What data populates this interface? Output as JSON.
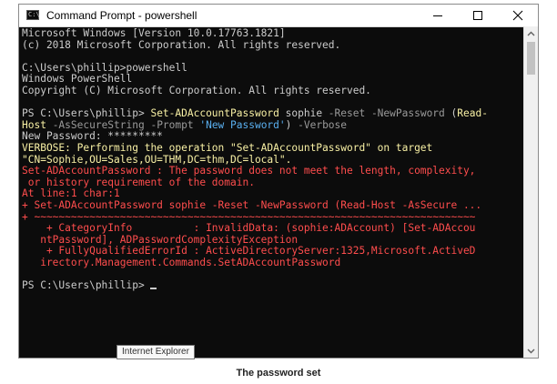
{
  "window": {
    "title": "Command Prompt - powershell",
    "icon": "cmd-app-icon",
    "icon_glyph": "C:\\",
    "controls": {
      "minimize": "minimize-icon",
      "maximize": "maximize-icon",
      "close": "close-icon"
    }
  },
  "console": {
    "colors": {
      "background": "#0c0c0c",
      "text": "#cccccc",
      "command": "#f9f1a5",
      "parameter": "#9a9a9a",
      "string": "#5ab0f0",
      "error": "#ff4d4d"
    },
    "lines": [
      [
        {
          "t": "Microsoft Windows [Version 10.0.17763.1821]",
          "c": ""
        }
      ],
      [
        {
          "t": "(c) 2018 Microsoft Corporation. All rights reserved.",
          "c": ""
        }
      ],
      [
        {
          "t": "",
          "c": ""
        }
      ],
      [
        {
          "t": "C:\\Users\\phillip>powershell",
          "c": ""
        }
      ],
      [
        {
          "t": "Windows PowerShell",
          "c": ""
        }
      ],
      [
        {
          "t": "Copyright (C) Microsoft Corporation. All rights reserved.",
          "c": ""
        }
      ],
      [
        {
          "t": "",
          "c": ""
        }
      ],
      [
        {
          "t": "PS C:\\Users\\phillip> ",
          "c": ""
        },
        {
          "t": "Set-ADAccountPassword",
          "c": "c-yel"
        },
        {
          "t": " sophie ",
          "c": ""
        },
        {
          "t": "-Reset -NewPassword",
          "c": "c-gray"
        },
        {
          "t": " (",
          "c": ""
        },
        {
          "t": "Read-",
          "c": "c-yel"
        }
      ],
      [
        {
          "t": "Host",
          "c": "c-yel"
        },
        {
          "t": " -AsSecureString -Prompt ",
          "c": "c-gray"
        },
        {
          "t": "'New Password'",
          "c": "c-blue"
        },
        {
          "t": ") ",
          "c": ""
        },
        {
          "t": "-Verbose",
          "c": "c-gray"
        }
      ],
      [
        {
          "t": "New Password: *********",
          "c": ""
        }
      ],
      [
        {
          "t": "VERBOSE: Performing the operation \"Set-ADAccountPassword\" on target",
          "c": "c-yel"
        }
      ],
      [
        {
          "t": "\"CN=Sophie,OU=Sales,OU=THM,DC=thm,DC=local\".",
          "c": "c-yel"
        }
      ],
      [
        {
          "t": "Set-ADAccountPassword : The password does not meet the length, complexity,",
          "c": "c-red"
        }
      ],
      [
        {
          "t": " or history requirement of the domain.",
          "c": "c-red"
        }
      ],
      [
        {
          "t": "At line:1 char:1",
          "c": "c-red"
        }
      ],
      [
        {
          "t": "+ Set-ADAccountPassword sophie -Reset -NewPassword (Read-Host -AsSecure ...",
          "c": "c-red"
        }
      ],
      [
        {
          "t": "+ ~~~~~~~~~~~~~~~~~~~~~~~~~~~~~~~~~~~~~~~~~~~~~~~~~~~~~~~~~~~~~~~~~~~~~~~~",
          "c": "c-red"
        }
      ],
      [
        {
          "t": "    + CategoryInfo          : InvalidData: (sophie:ADAccount) [Set-ADAccou",
          "c": "c-red"
        }
      ],
      [
        {
          "t": "   ntPassword], ADPasswordComplexityException",
          "c": "c-red"
        }
      ],
      [
        {
          "t": "    + FullyQualifiedErrorId : ActiveDirectoryServer:1325,Microsoft.ActiveD",
          "c": "c-red"
        }
      ],
      [
        {
          "t": "   irectory.Management.Commands.SetADAccountPassword",
          "c": "c-red"
        }
      ],
      [
        {
          "t": "",
          "c": ""
        }
      ],
      [
        {
          "t": "PS C:\\Users\\phillip> ",
          "c": "",
          "cursor": true
        }
      ]
    ]
  },
  "scrollbar": {
    "up": "scroll-up-arrow-icon",
    "down": "scroll-down-arrow-icon"
  },
  "tooltip": {
    "text": "Internet Explorer"
  },
  "caption": {
    "text": "The password set"
  }
}
